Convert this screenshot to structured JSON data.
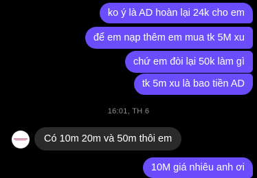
{
  "conversation": {
    "messages": [
      {
        "sender": "me",
        "text": "ko ý là AD hoàn lại 24k cho em"
      },
      {
        "sender": "me",
        "text": "để em nạp thêm em mua tk 5M xu"
      },
      {
        "sender": "me",
        "text": "chứ em đòi lại 50k làm gì"
      },
      {
        "sender": "me",
        "text": "tk 5m xu là bao tiền AD"
      },
      {
        "sender": "other",
        "text": "Có 10m 20m và 50m thôi em"
      },
      {
        "sender": "me",
        "text": "10M giá nhiêu anh ơi"
      }
    ],
    "timestamp": "16:01, TH 6"
  },
  "colors": {
    "background": "#000000",
    "sent_bubble": "#6b4dfd",
    "received_bubble": "#2a2a2b",
    "timestamp_text": "#8e8e93"
  },
  "icons": {
    "avatar": "shop-logo-avatar"
  }
}
